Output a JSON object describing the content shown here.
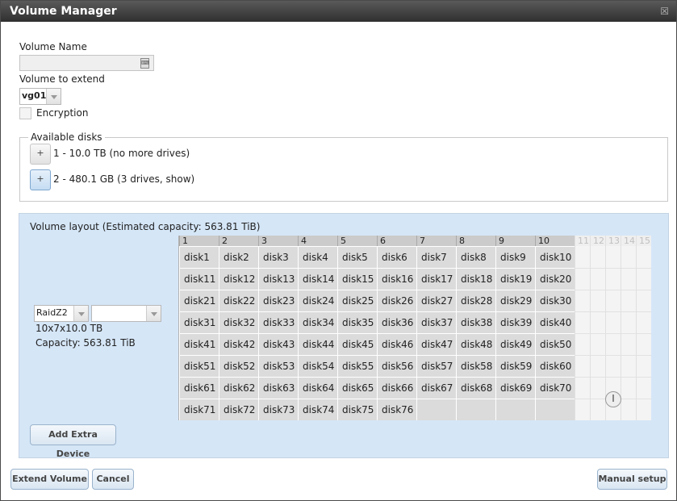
{
  "window": {
    "title": "Volume Manager",
    "close_icon": "close-icon"
  },
  "form": {
    "volume_name_label": "Volume Name",
    "volume_name_value": "",
    "extend_label": "Volume to extend",
    "extend_value": "vg01",
    "encryption_label": "Encryption"
  },
  "available": {
    "legend": "Available disks",
    "groups": [
      {
        "button": "+",
        "label": "1 - 10.0 TB (no more drives)"
      },
      {
        "button": "+",
        "label": "2 - 480.1 GB (3 drives, show)"
      }
    ]
  },
  "layout": {
    "legend": "Volume layout (Estimated capacity: 563.81 TiB)",
    "raid_value": "RaidZ2",
    "second_value": "",
    "size_text": "10x7x10.0 TB",
    "capacity_text": "Capacity: 563.81 TiB",
    "columns": [
      "1",
      "2",
      "3",
      "4",
      "5",
      "6",
      "7",
      "8",
      "9",
      "10",
      "11",
      "12",
      "13",
      "14",
      "15"
    ],
    "rows": [
      [
        "disk1",
        "disk2",
        "disk3",
        "disk4",
        "disk5",
        "disk6",
        "disk7",
        "disk8",
        "disk9",
        "disk10"
      ],
      [
        "disk11",
        "disk12",
        "disk13",
        "disk14",
        "disk15",
        "disk16",
        "disk17",
        "disk18",
        "disk19",
        "disk20"
      ],
      [
        "disk21",
        "disk22",
        "disk23",
        "disk24",
        "disk25",
        "disk26",
        "disk27",
        "disk28",
        "disk29",
        "disk30"
      ],
      [
        "disk31",
        "disk32",
        "disk33",
        "disk34",
        "disk35",
        "disk36",
        "disk37",
        "disk38",
        "disk39",
        "disk40"
      ],
      [
        "disk41",
        "disk42",
        "disk43",
        "disk44",
        "disk45",
        "disk46",
        "disk47",
        "disk48",
        "disk49",
        "disk50"
      ],
      [
        "disk51",
        "disk52",
        "disk53",
        "disk54",
        "disk55",
        "disk56",
        "disk57",
        "disk58",
        "disk59",
        "disk60"
      ],
      [
        "disk61",
        "disk62",
        "disk63",
        "disk64",
        "disk65",
        "disk66",
        "disk67",
        "disk68",
        "disk69",
        "disk70"
      ],
      [
        "disk71",
        "disk72",
        "disk73",
        "disk74",
        "disk75",
        "disk76",
        "",
        "",
        "",
        ""
      ]
    ],
    "add_extra_label": "Add Extra Device"
  },
  "footer": {
    "extend_label": "Extend Volume",
    "cancel_label": "Cancel",
    "manual_label": "Manual setup"
  }
}
